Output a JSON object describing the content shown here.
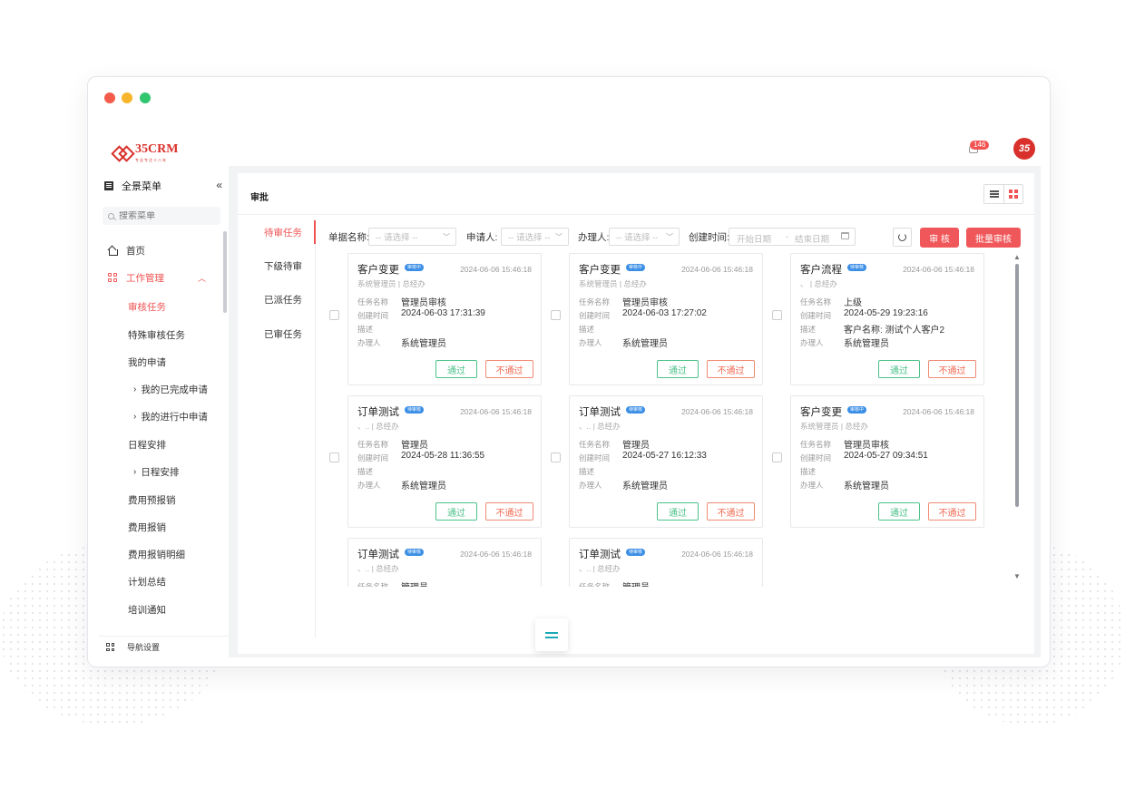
{
  "app": {
    "logo_text": "35CRM",
    "logo_tagline": "专业专注十八年",
    "notification_count": "146",
    "user_logo_text": "35"
  },
  "sidebar": {
    "title": "全景菜单",
    "search_placeholder": "搜索菜单",
    "items": [
      {
        "label": "首页"
      },
      {
        "label": "工作管理"
      },
      {
        "label": "审核任务"
      },
      {
        "label": "特殊审核任务"
      },
      {
        "label": "我的申请"
      },
      {
        "label": "我的已完成申请"
      },
      {
        "label": "我的进行中申请"
      },
      {
        "label": "日程安排"
      },
      {
        "label": "日程安排"
      },
      {
        "label": "费用预报销"
      },
      {
        "label": "费用报销"
      },
      {
        "label": "费用报销明细"
      },
      {
        "label": "计划总结"
      },
      {
        "label": "培训通知"
      }
    ],
    "bottom_label": "导航设置"
  },
  "content": {
    "title": "审批",
    "tabs": [
      "待审任务",
      "下级待审",
      "已派任务",
      "已审任务"
    ],
    "filters": {
      "doc_name_label": "单据名称:",
      "doc_name_placeholder": "-- 请选择 --",
      "applicant_label": "申请人:",
      "applicant_placeholder": "-- 请选择 --",
      "handler_label": "办理人:",
      "handler_placeholder": "-- 请选择 --",
      "created_label": "创建时间:",
      "start_placeholder": "开始日期",
      "range_sep": "-",
      "end_placeholder": "结束日期"
    },
    "approve_btn": "审 核",
    "batch_btn": "批量审核"
  },
  "card_labels": {
    "task_name": "任务名称",
    "created": "创建时间",
    "desc": "描述",
    "handler": "办理人",
    "pass": "通过",
    "fail": "不通过"
  },
  "cards": [
    {
      "title": "客户变更",
      "tag": "审核中",
      "time": "2024-06-06 15:46:18",
      "sub": "系统管理员 | 总经办",
      "task": "管理员审核",
      "created": "2024-06-03 17:31:39",
      "desc": "",
      "handler": "系统管理员"
    },
    {
      "title": "客户变更",
      "tag": "审核中",
      "time": "2024-06-06 15:46:18",
      "sub": "系统管理员 | 总经办",
      "task": "管理员审核",
      "created": "2024-06-03 17:27:02",
      "desc": "",
      "handler": "系统管理员"
    },
    {
      "title": "客户流程",
      "tag": "待审核",
      "time": "2024-06-06 15:46:18",
      "sub": "、 | 总经办",
      "task": "上级",
      "created": "2024-05-29 19:23:16",
      "desc": "客户名称: 测试个人客户2",
      "handler": "系统管理员"
    },
    {
      "title": "订单测试",
      "tag": "待审核",
      "time": "2024-06-06 15:46:18",
      "sub": "、.. | 总经办",
      "task": "管理员",
      "created": "2024-05-28 11:36:55",
      "desc": "",
      "handler": "系统管理员"
    },
    {
      "title": "订单测试",
      "tag": "待审核",
      "time": "2024-06-06 15:46:18",
      "sub": "、.. | 总经办",
      "task": "管理员",
      "created": "2024-05-27 16:12:33",
      "desc": "",
      "handler": "系统管理员"
    },
    {
      "title": "客户变更",
      "tag": "审核中",
      "time": "2024-06-06 15:46:18",
      "sub": "系统管理员 | 总经办",
      "task": "管理员审核",
      "created": "2024-05-27 09:34:51",
      "desc": "",
      "handler": "系统管理员"
    },
    {
      "title": "订单测试",
      "tag": "待审核",
      "time": "2024-06-06 15:46:18",
      "sub": "、.. | 总经办",
      "task": "管理员",
      "created": "",
      "desc": "",
      "handler": ""
    },
    {
      "title": "订单测试",
      "tag": "待审核",
      "time": "2024-06-06 15:46:18",
      "sub": "、.. | 总经办",
      "task": "管理员",
      "created": "",
      "desc": "",
      "handler": ""
    }
  ]
}
